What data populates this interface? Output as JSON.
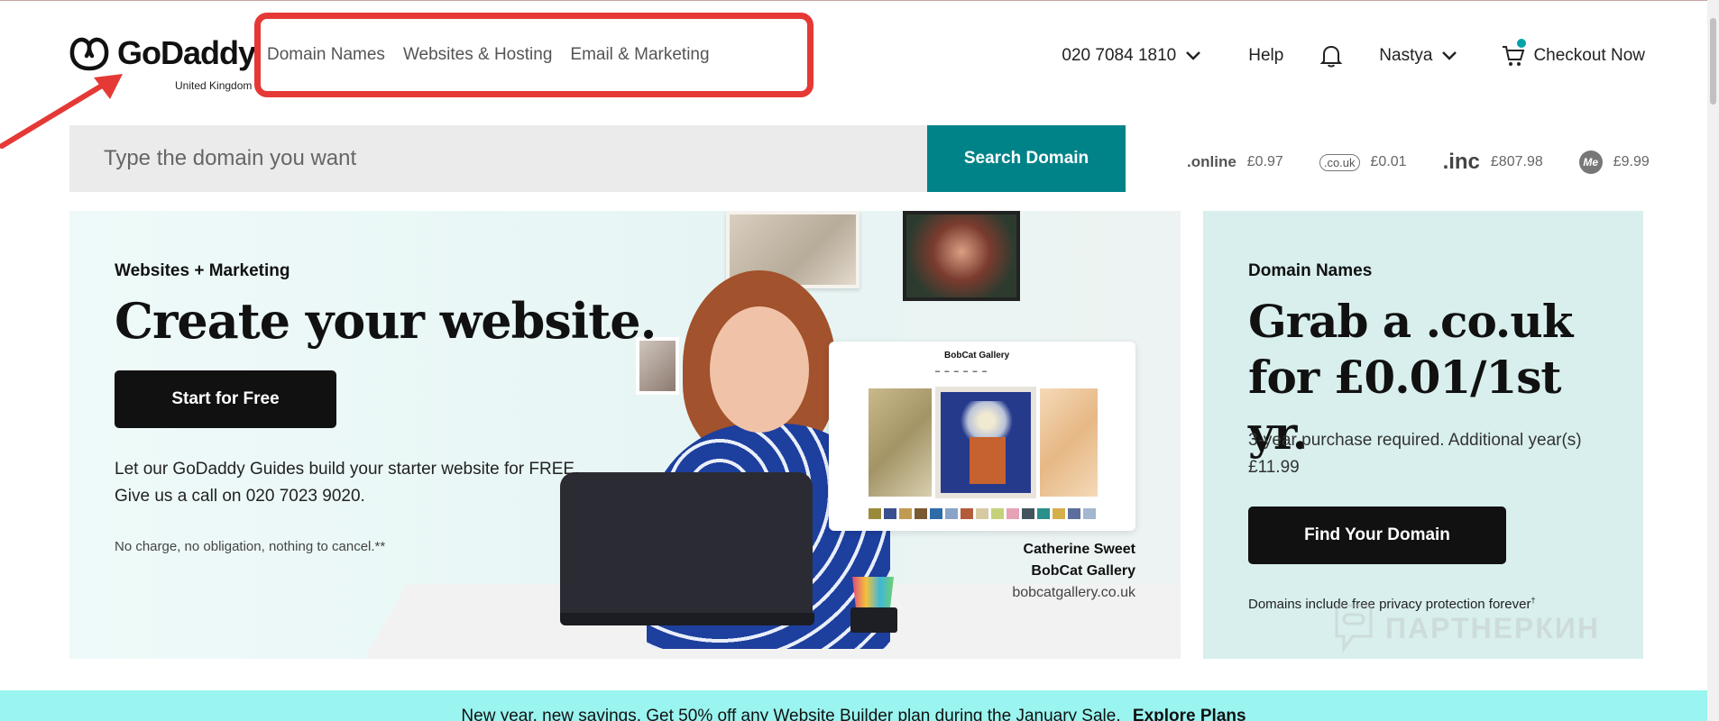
{
  "header": {
    "logo_text": "GoDaddy",
    "logo_region": "United Kingdom",
    "nav": [
      "Domain Names",
      "Websites & Hosting",
      "Email & Marketing"
    ],
    "phone": "020 7084 1810",
    "help": "Help",
    "user": "Nastya",
    "checkout": "Checkout Now"
  },
  "search": {
    "placeholder": "Type the domain you want",
    "button": "Search Domain"
  },
  "tlds": [
    {
      "logo": ".online",
      "price": "£0.97"
    },
    {
      "logo": ".co.uk",
      "price": "£0.01"
    },
    {
      "logo": ".inc",
      "price": "£807.98"
    },
    {
      "logo": "Me",
      "price": "£9.99"
    }
  ],
  "hero_left": {
    "kicker": "Websites + Marketing",
    "title": "Create your website.",
    "button": "Start for Free",
    "body": "Let our GoDaddy Guides build your starter website for FREE. Give us a call on 020 7023 9020.",
    "fine_print": "No charge, no obligation, nothing to cancel.**",
    "card_brand": "BobCat Gallery",
    "caption_name": "Catherine Sweet",
    "caption_business": "BobCat Gallery",
    "caption_url": "bobcatgallery.co.uk"
  },
  "hero_right": {
    "kicker": "Domain Names",
    "title": "Grab a .co.uk for £0.01/1st yr.",
    "body": "3-year purchase required. Additional year(s) £11.99",
    "button": "Find Your Domain",
    "fine_print": "Domains include free privacy protection forever",
    "fine_sup": "†"
  },
  "watermark": "ПАРТНЕРКИН",
  "banner": {
    "text": "New year, new savings. Get 50% off any Website Builder plan during the January Sale.",
    "link": "Explore Plans"
  },
  "colors": {
    "search_button": "#008388",
    "annotation": "#e53935",
    "banner": "#9af4ef",
    "hero_right_bg": "#d8efed"
  }
}
